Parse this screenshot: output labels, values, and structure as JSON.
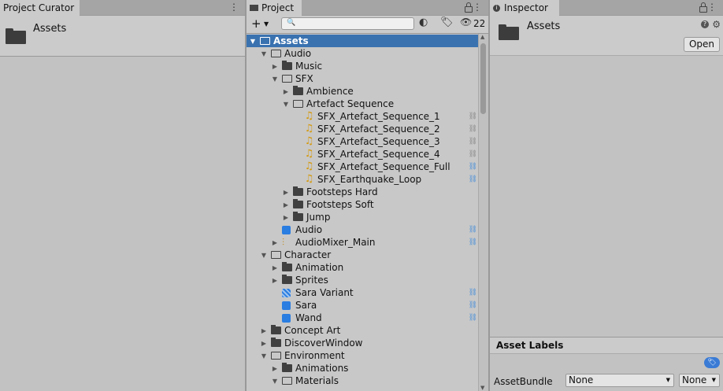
{
  "curator": {
    "tab": "Project Curator",
    "menu_icon": "kebab-menu-icon",
    "folder_label": "Assets"
  },
  "project": {
    "tab": "Project",
    "add_label": "+",
    "search_placeholder": "",
    "hidden_count": "22",
    "rows": [
      {
        "label": "Assets",
        "depth": 0,
        "arrow": "open",
        "icon": "folder-open",
        "selected": true
      },
      {
        "label": "Audio",
        "depth": 1,
        "arrow": "open",
        "icon": "folder-open"
      },
      {
        "label": "Music",
        "depth": 2,
        "arrow": "closed",
        "icon": "folder"
      },
      {
        "label": "SFX",
        "depth": 2,
        "arrow": "open",
        "icon": "folder-open"
      },
      {
        "label": "Ambience",
        "depth": 3,
        "arrow": "closed",
        "icon": "folder"
      },
      {
        "label": "Artefact Sequence",
        "depth": 3,
        "arrow": "open",
        "icon": "folder-open"
      },
      {
        "label": "SFX_Artefact_Sequence_1",
        "depth": 4,
        "arrow": "none",
        "icon": "audio",
        "link": "grey"
      },
      {
        "label": "SFX_Artefact_Sequence_2",
        "depth": 4,
        "arrow": "none",
        "icon": "audio",
        "link": "grey"
      },
      {
        "label": "SFX_Artefact_Sequence_3",
        "depth": 4,
        "arrow": "none",
        "icon": "audio",
        "link": "grey"
      },
      {
        "label": "SFX_Artefact_Sequence_4",
        "depth": 4,
        "arrow": "none",
        "icon": "audio",
        "link": "grey"
      },
      {
        "label": "SFX_Artefact_Sequence_Full",
        "depth": 4,
        "arrow": "none",
        "icon": "audio",
        "link": "blue"
      },
      {
        "label": "SFX_Earthquake_Loop",
        "depth": 4,
        "arrow": "none",
        "icon": "audio",
        "link": "blue"
      },
      {
        "label": "Footsteps Hard",
        "depth": 3,
        "arrow": "closed",
        "icon": "folder"
      },
      {
        "label": "Footsteps Soft",
        "depth": 3,
        "arrow": "closed",
        "icon": "folder"
      },
      {
        "label": "Jump",
        "depth": 3,
        "arrow": "closed",
        "icon": "folder"
      },
      {
        "label": "Audio",
        "depth": 2,
        "arrow": "none",
        "icon": "prefab",
        "link": "blue"
      },
      {
        "label": "AudioMixer_Main",
        "depth": 2,
        "arrow": "closed",
        "icon": "mixer",
        "link": "blue"
      },
      {
        "label": "Character",
        "depth": 1,
        "arrow": "open",
        "icon": "folder-open"
      },
      {
        "label": "Animation",
        "depth": 2,
        "arrow": "closed",
        "icon": "folder"
      },
      {
        "label": "Sprites",
        "depth": 2,
        "arrow": "closed",
        "icon": "folder"
      },
      {
        "label": "Sara Variant",
        "depth": 2,
        "arrow": "none",
        "icon": "variant",
        "link": "blue"
      },
      {
        "label": "Sara",
        "depth": 2,
        "arrow": "none",
        "icon": "prefab",
        "link": "blue"
      },
      {
        "label": "Wand",
        "depth": 2,
        "arrow": "none",
        "icon": "prefab",
        "link": "blue"
      },
      {
        "label": "Concept Art",
        "depth": 1,
        "arrow": "closed",
        "icon": "folder"
      },
      {
        "label": "DiscoverWindow",
        "depth": 1,
        "arrow": "closed",
        "icon": "folder"
      },
      {
        "label": "Environment",
        "depth": 1,
        "arrow": "open",
        "icon": "folder-open"
      },
      {
        "label": "Animations",
        "depth": 2,
        "arrow": "closed",
        "icon": "folder"
      },
      {
        "label": "Materials",
        "depth": 2,
        "arrow": "open",
        "icon": "folder-open"
      }
    ]
  },
  "inspector": {
    "tab": "Inspector",
    "title": "Assets",
    "open_label": "Open",
    "asset_labels": "Asset Labels",
    "assetbundle_label": "AssetBundle",
    "bundle_value": "None",
    "variant_value": "None"
  },
  "colors": {
    "selection": "#3a72b0",
    "audio_icon": "#d49a10",
    "prefab_icon": "#2a7de1"
  }
}
